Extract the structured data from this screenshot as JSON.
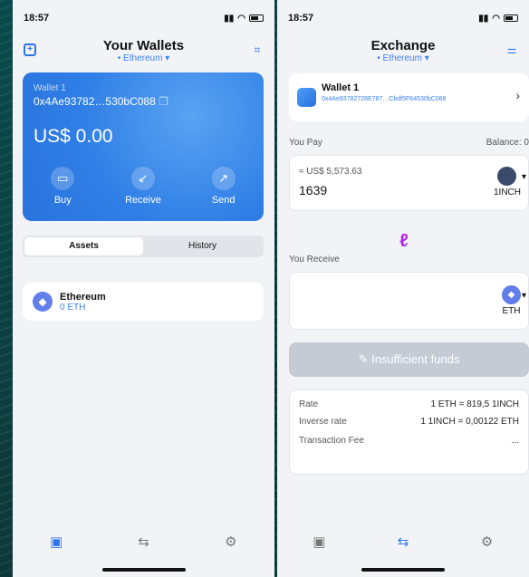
{
  "left": {
    "status": {
      "time": "18:57",
      "signal": "ull",
      "wifi": "≋"
    },
    "nav": {
      "title": "Your Wallets",
      "network": "• Ethereum ▾"
    },
    "card": {
      "wallet_name": "Wallet 1",
      "address": "0x4Ae93782…530bC088",
      "balance": "US$ 0.00",
      "actions": [
        "Buy",
        "Receive",
        "Send"
      ]
    },
    "tabs": [
      "Assets",
      "History"
    ],
    "assets": [
      {
        "name": "Ethereum",
        "amount": "0 ETH"
      }
    ]
  },
  "right": {
    "status": {
      "time": "18:57"
    },
    "nav": {
      "title": "Exchange",
      "network": "• Ethereum ▾"
    },
    "wallet": {
      "name": "Wallet 1",
      "address": "0x4Ae93782728E787…Cbdf5F64530bC088"
    },
    "you_pay": {
      "label": "You Pay",
      "balance_label": "Balance: 0",
      "usd": "≈ US$ 5,573.63",
      "amount": "1639",
      "token": "1INCH"
    },
    "you_receive": {
      "label": "You Receive",
      "token": "ETH"
    },
    "button": "Insufficient funds",
    "info": {
      "rate_label": "Rate",
      "rate_value": "1 ETH = 819,5 1INCH",
      "inverse_label": "Inverse rate",
      "inverse_value": "1 1INCH = 0,00122 ETH",
      "fee_label": "Transaction Fee",
      "fee_value": "..."
    }
  },
  "colors": {
    "accent": "#2d74ea",
    "swap": "#b027e9",
    "eth": "#627eea"
  }
}
